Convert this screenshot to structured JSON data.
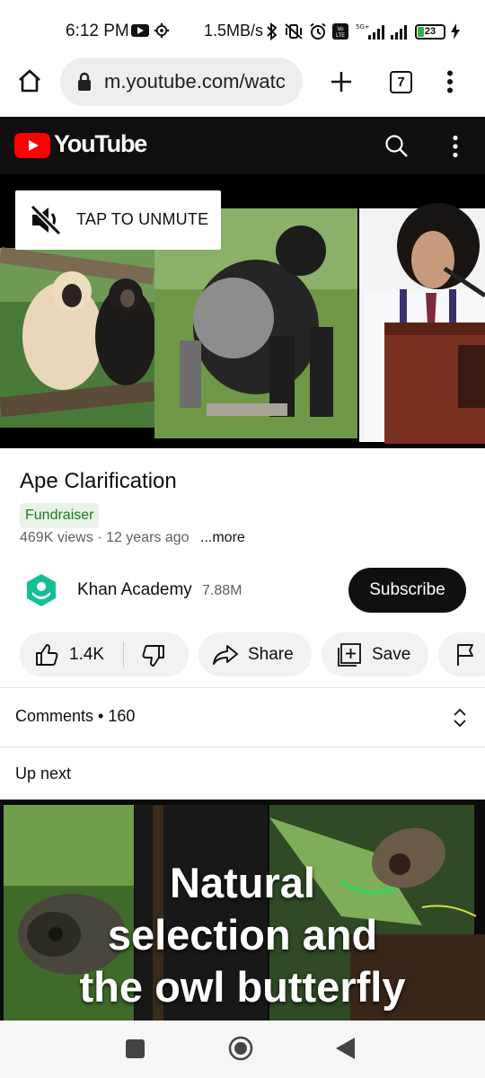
{
  "status_bar": {
    "time": "6:12 PM",
    "network_speed": "1.5MB/s",
    "battery_level": "23",
    "icons": [
      "video-record-icon",
      "gear-icon",
      "bluetooth-icon",
      "vibrate-icon",
      "alarm-icon",
      "volte-icon",
      "signal-icon",
      "signal-icon",
      "battery-icon",
      "charging-icon"
    ]
  },
  "browser": {
    "url": "m.youtube.com/watc",
    "tab_count": "7"
  },
  "youtube_header": {
    "logo_text": "YouTube",
    "brand_color": "#ff0000"
  },
  "player": {
    "unmute_label": "TAP TO UNMUTE"
  },
  "video": {
    "title": "Ape Clarification",
    "badge": "Fundraiser",
    "meta": "469K views · 12 years ago",
    "more_label": "...more"
  },
  "channel": {
    "name": "Khan Academy",
    "subscribers": "7.88M",
    "subscribe_label": "Subscribe",
    "avatar_color": "#14bf96"
  },
  "actions": {
    "likes": "1.4K",
    "share_label": "Share",
    "save_label": "Save"
  },
  "comments": {
    "label": "Comments • 160"
  },
  "up_next": {
    "label": "Up next",
    "thumbnail_text": [
      "Natural",
      "selection and",
      "the owl butterfly"
    ]
  }
}
